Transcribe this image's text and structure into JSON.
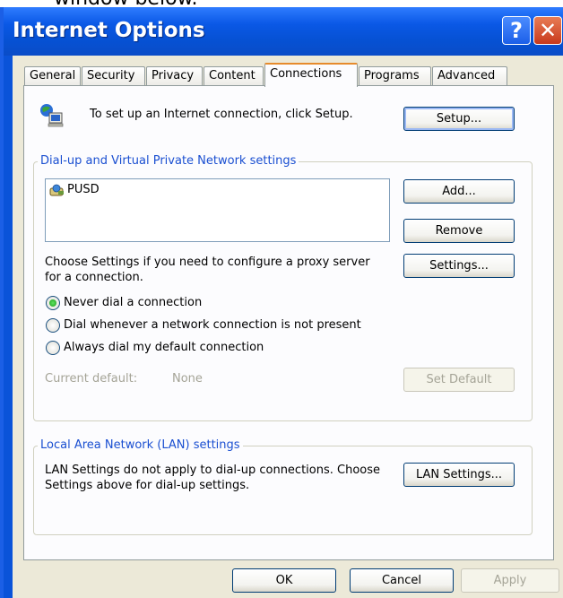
{
  "page_caption": "window below.",
  "window": {
    "title": "Internet Options",
    "help_glyph": "?",
    "close_glyph": "✕"
  },
  "tabs": [
    "General",
    "Security",
    "Privacy",
    "Content",
    "Connections",
    "Programs",
    "Advanced"
  ],
  "active_tab": "Connections",
  "setup": {
    "text": "To set up an Internet connection, click Setup.",
    "button": "Setup..."
  },
  "dialup": {
    "legend": "Dial-up and Virtual Private Network settings",
    "entries": [
      "PUSD"
    ],
    "add_button": "Add...",
    "remove_button": "Remove",
    "proxy_text_line1": "Choose Settings if you need to configure a proxy server",
    "proxy_text_line2": "for a connection.",
    "settings_button": "Settings...",
    "options": [
      "Never dial a connection",
      "Dial whenever a network connection is not present",
      "Always dial my default connection"
    ],
    "selected_option": "Never dial a connection",
    "current_default_label": "Current default:",
    "current_default_value": "None",
    "set_default_button": "Set Default"
  },
  "lan": {
    "legend": "Local Area Network (LAN) settings",
    "text_line1": "LAN Settings do not apply to dial-up connections. Choose",
    "text_line2": "Settings above for dial-up settings.",
    "button": "LAN Settings..."
  },
  "footer": {
    "ok": "OK",
    "cancel": "Cancel",
    "apply": "Apply"
  },
  "colors": {
    "titlebar": "#0a58e6",
    "dialog_bg": "#ece9d8",
    "group_legend": "#1a4fd1",
    "active_tab_accent": "#e68b2c"
  }
}
